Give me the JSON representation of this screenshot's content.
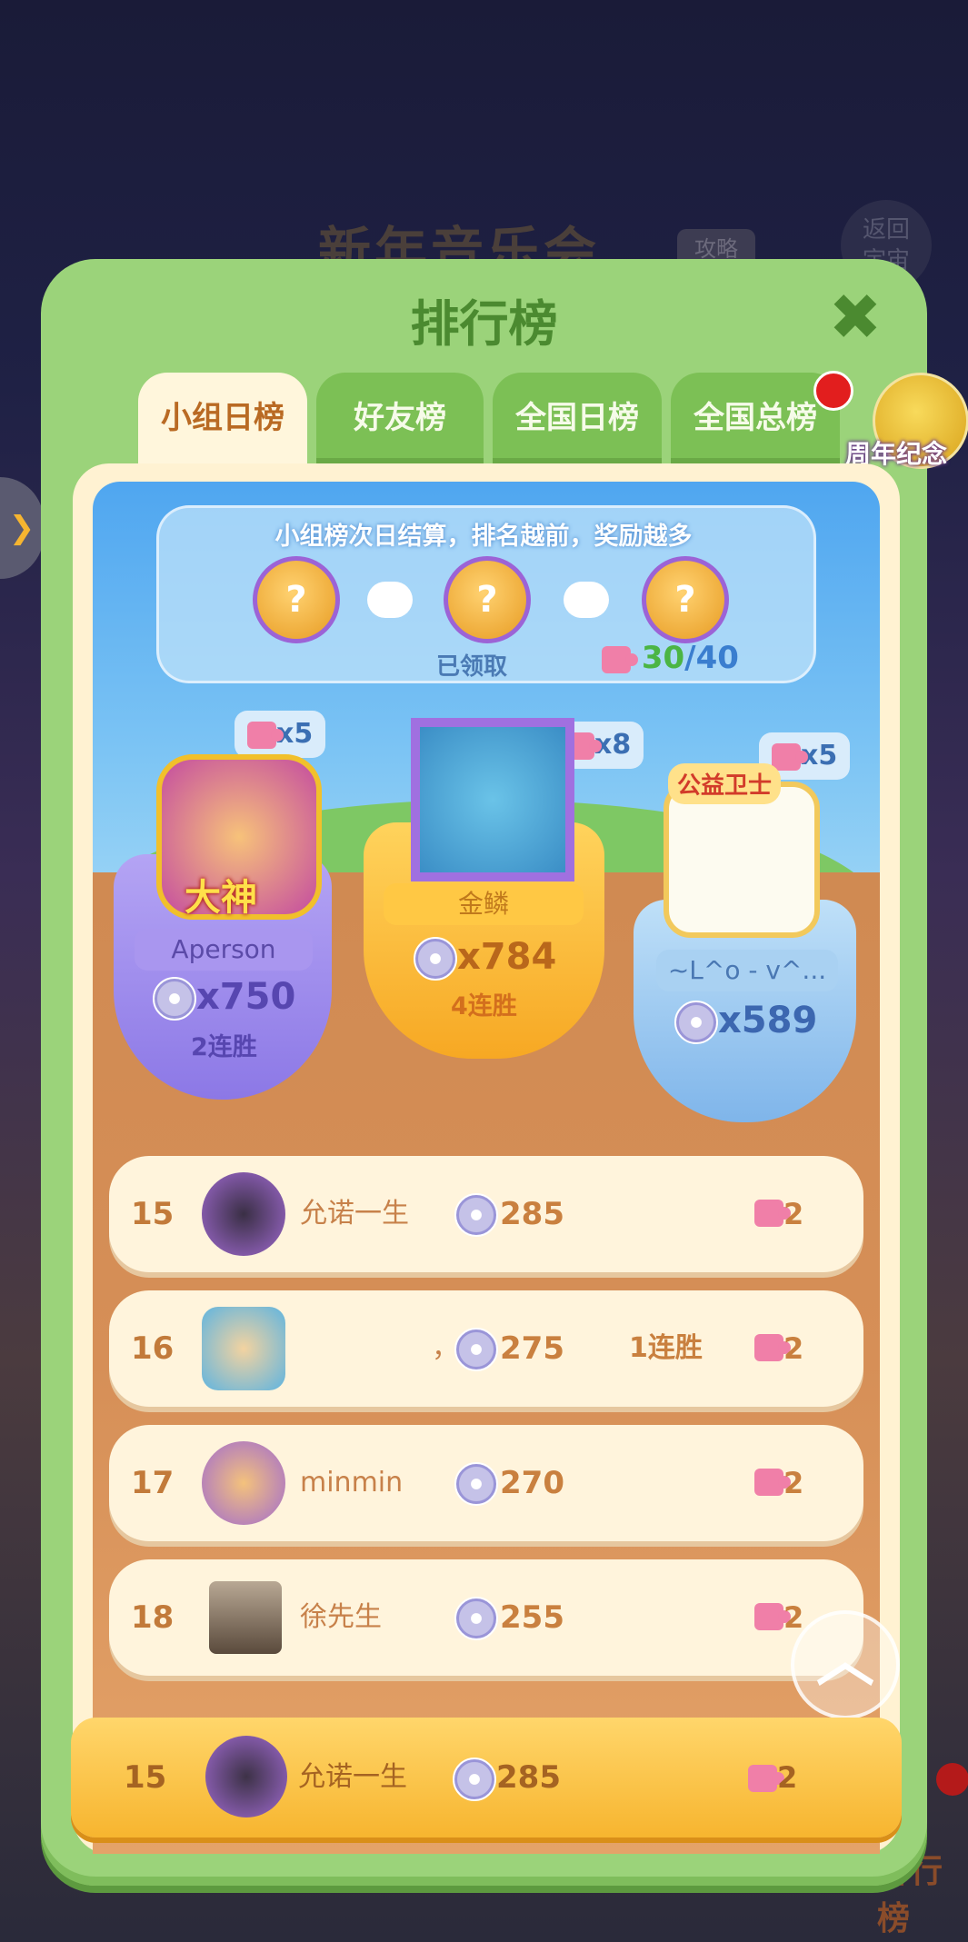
{
  "background": {
    "event_title": "新年音乐会",
    "strategy_label": "攻略",
    "return_label": "返回\n宇宙",
    "bottom_text": "排行榜"
  },
  "panel": {
    "title": "排行榜",
    "close_icon": "close-icon"
  },
  "tabs": [
    {
      "label": "小组日榜",
      "active": true
    },
    {
      "label": "好友榜",
      "active": false
    },
    {
      "label": "全国日榜",
      "active": false
    },
    {
      "label": "全国总榜",
      "active": false
    }
  ],
  "anniversary": {
    "label": "周年纪念币"
  },
  "rewards": {
    "banner_text": "小组榜次日结算，排名越前，奖励越多",
    "claimed_label": "已领取",
    "progress_current": "30",
    "progress_total": "/40"
  },
  "podium": {
    "first": {
      "name": "金鳞",
      "score": "x784",
      "streak": "4连胜",
      "pieces": "x8"
    },
    "second": {
      "name": "Aperson",
      "score": "x750",
      "streak": "2连胜",
      "pieces": "x5",
      "badge": "大神"
    },
    "third": {
      "name": "~L^o - v^...",
      "score": "x589",
      "streak": "",
      "pieces": "x5",
      "badge": "公益卫士"
    }
  },
  "rows": [
    {
      "rank": "15",
      "name": "允诺一生",
      "score": "285",
      "streak": "",
      "pieces": "2"
    },
    {
      "rank": "16",
      "name": "，",
      "score": "275",
      "streak": "1连胜",
      "pieces": "2"
    },
    {
      "rank": "17",
      "name": "minmin",
      "score": "270",
      "streak": "",
      "pieces": "2"
    },
    {
      "rank": "18",
      "name": "徐先生",
      "score": "255",
      "streak": "",
      "pieces": "2"
    }
  ],
  "self_row": {
    "rank": "15",
    "name": "允诺一生",
    "score": "285",
    "pieces": "2"
  },
  "colors": {
    "panel_green": "#9bd37a",
    "tab_active": "#fff6dc",
    "accent_orange": "#c9803f",
    "progress_green": "#4bb544"
  }
}
